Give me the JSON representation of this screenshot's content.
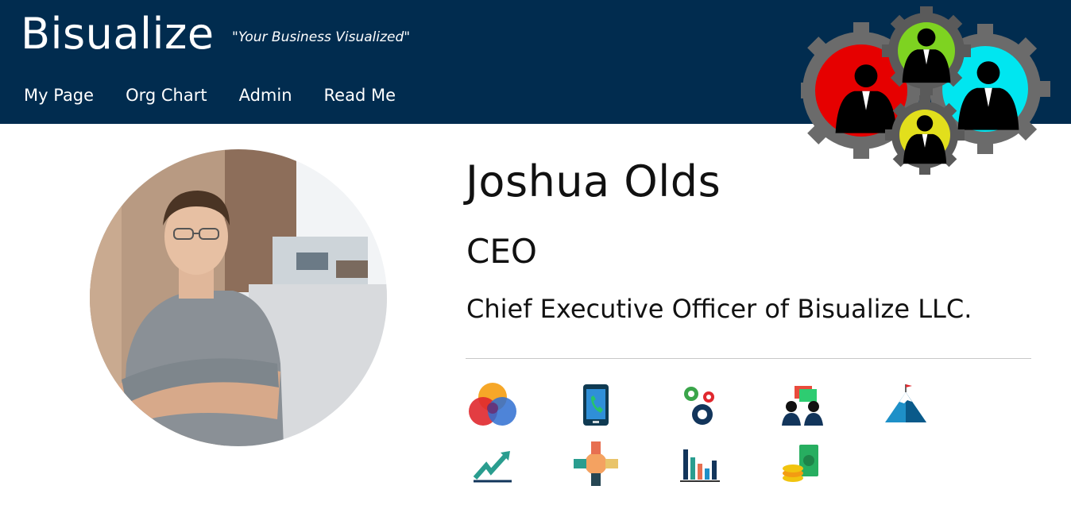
{
  "header": {
    "brand": "Bisualize",
    "tagline": "\"Your Business Visualized\"",
    "nav": [
      "My Page",
      "Org Chart",
      "Admin",
      "Read Me"
    ]
  },
  "profile": {
    "name": "Joshua Olds",
    "role": "CEO",
    "description": "Chief Executive Officer of Bisualize LLC."
  },
  "skill_icons": [
    "venn-diagram-icon",
    "smartphone-call-icon",
    "gears-icon",
    "business-people-meeting-icon",
    "mountain-flag-icon",
    "trend-growth-icon",
    "teamwork-hands-icon",
    "bar-chart-icon",
    "coins-money-icon"
  ],
  "colors": {
    "header_bg": "#012c4f",
    "logo_red": "#e60000",
    "logo_green": "#7ed321",
    "logo_cyan": "#00e6f0",
    "logo_yellow": "#e2df1c"
  }
}
